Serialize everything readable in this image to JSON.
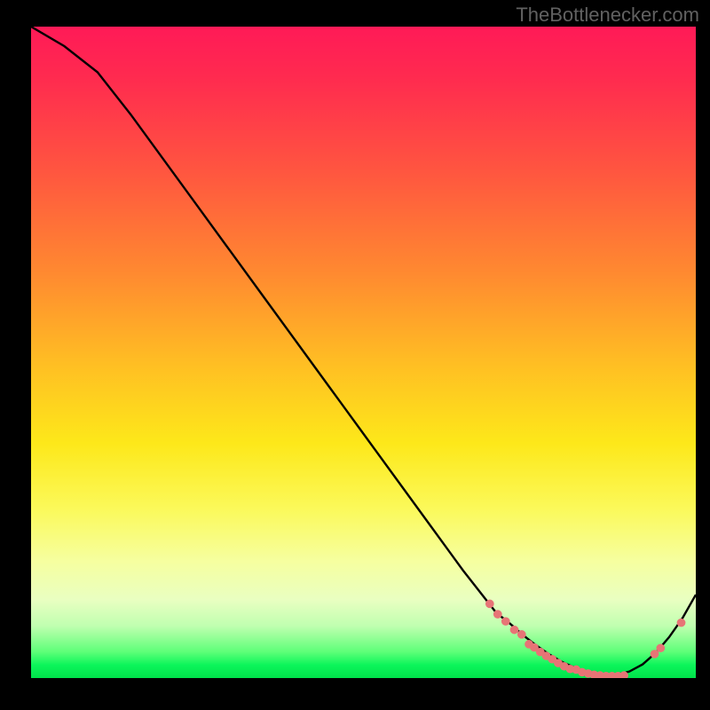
{
  "watermark": "TheBottlenecker.com",
  "chart_data": {
    "type": "line",
    "title": "",
    "xlabel": "",
    "ylabel": "",
    "xlim": [
      0,
      100
    ],
    "ylim": [
      0,
      100
    ],
    "curve": {
      "x": [
        0,
        5,
        10,
        15,
        20,
        25,
        30,
        35,
        40,
        45,
        50,
        55,
        60,
        65,
        70,
        72,
        74,
        76,
        78,
        80,
        82,
        84,
        86,
        88,
        90,
        92,
        94,
        96,
        98,
        100
      ],
      "y": [
        100,
        97,
        93,
        86.5,
        79.5,
        72.5,
        65.5,
        58.5,
        51.5,
        44.5,
        37.5,
        30.5,
        23.5,
        16.5,
        10,
        8.4,
        6.6,
        5.0,
        3.6,
        2.4,
        1.5,
        0.9,
        0.5,
        0.5,
        1.0,
        2.1,
        3.9,
        6.3,
        9.2,
        12.8
      ]
    },
    "points": [
      {
        "x": 69.0,
        "y": 11.4
      },
      {
        "x": 70.2,
        "y": 9.8
      },
      {
        "x": 71.4,
        "y": 8.7
      },
      {
        "x": 72.7,
        "y": 7.4
      },
      {
        "x": 73.8,
        "y": 6.7
      },
      {
        "x": 74.9,
        "y": 5.2
      },
      {
        "x": 75.7,
        "y": 4.7
      },
      {
        "x": 76.6,
        "y": 4.0
      },
      {
        "x": 77.5,
        "y": 3.4
      },
      {
        "x": 78.4,
        "y": 2.9
      },
      {
        "x": 79.3,
        "y": 2.3
      },
      {
        "x": 80.2,
        "y": 1.8
      },
      {
        "x": 81.1,
        "y": 1.4
      },
      {
        "x": 82.0,
        "y": 1.3
      },
      {
        "x": 82.9,
        "y": 0.9
      },
      {
        "x": 83.8,
        "y": 0.7
      },
      {
        "x": 84.7,
        "y": 0.5
      },
      {
        "x": 85.6,
        "y": 0.4
      },
      {
        "x": 86.5,
        "y": 0.3
      },
      {
        "x": 87.4,
        "y": 0.3
      },
      {
        "x": 88.3,
        "y": 0.3
      },
      {
        "x": 89.2,
        "y": 0.4
      },
      {
        "x": 93.8,
        "y": 3.7
      },
      {
        "x": 94.7,
        "y": 4.6
      },
      {
        "x": 97.8,
        "y": 8.5
      }
    ],
    "point_color": "#e77476",
    "curve_color": "#000000"
  }
}
